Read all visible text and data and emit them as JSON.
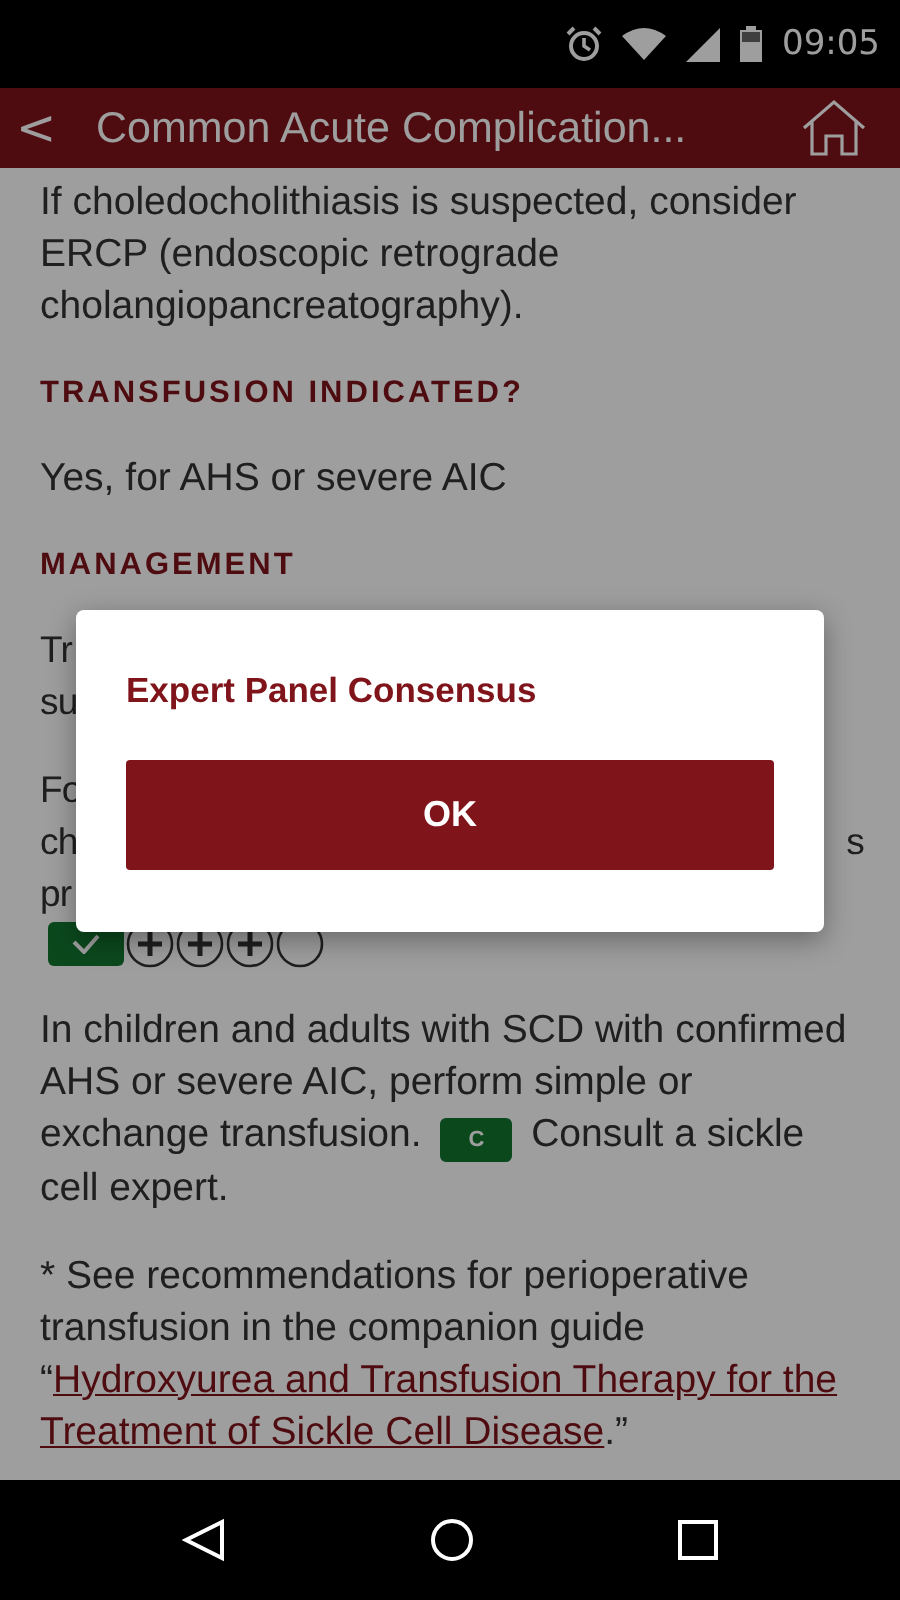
{
  "status_bar": {
    "time": "09:05"
  },
  "header": {
    "back": "<",
    "title": "Common Acute Complication..."
  },
  "content": [
    {
      "kind": "paragraph",
      "text": "If choledocholithiasis is suspected, consider ERCP (endoscopic retrograde cholangiopancreatography)."
    },
    {
      "kind": "heading",
      "text": "TRANSFUSION INDICATED?"
    },
    {
      "kind": "paragraph",
      "text": "Yes, for AHS or severe AIC"
    },
    {
      "kind": "heading",
      "text": "MANAGEMENT"
    },
    {
      "kind": "partial",
      "lines": [
        {
          "left": "Tr"
        },
        {
          "left": "su"
        }
      ]
    },
    {
      "kind": "partial",
      "lines": [
        {
          "left": "Fo"
        },
        {
          "left": "ch",
          "right": "s"
        },
        {
          "left": "pr"
        }
      ]
    },
    {
      "kind": "rating",
      "circles": [
        {
          "filled": true
        },
        {
          "filled": true
        },
        {
          "filled": true
        },
        {
          "filled": false
        }
      ]
    },
    {
      "kind": "segments",
      "parts": [
        {
          "kind": "text",
          "text": "In children and adults with SCD with confirmed AHS or severe AIC, perform simple or exchange transfusion. "
        },
        {
          "kind": "badge",
          "text": "C"
        },
        {
          "kind": "text",
          "text": " Consult a sickle cell expert."
        }
      ]
    },
    {
      "kind": "segments",
      "parts": [
        {
          "kind": "text",
          "text": "* See recommendations for perioperative transfusion in the companion guide “"
        },
        {
          "kind": "link",
          "text": "Hydroxyurea and Transfusion Therapy for the"
        },
        {
          "kind": "link",
          "text": "Treatment of Sickle Cell Disease"
        },
        {
          "kind": "text",
          "text": ".”"
        }
      ]
    }
  ],
  "dialog": {
    "title": "Expert Panel Consensus",
    "button": "OK"
  }
}
